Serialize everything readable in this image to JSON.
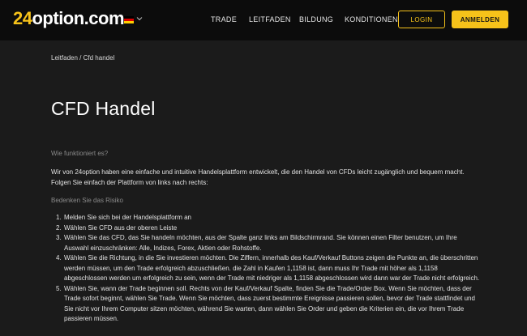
{
  "header": {
    "logo_digits": "24",
    "logo_text": "option.com",
    "language_icon": "german-flag-icon",
    "nav": [
      {
        "label": "TRADE"
      },
      {
        "label": "LEITFADEN"
      },
      {
        "label": "BILDUNG"
      },
      {
        "label": "KONDITIONEN"
      }
    ],
    "login_label": "LOGIN",
    "register_label": "ANMELDEN"
  },
  "colors": {
    "accent": "#f6c21a",
    "header_bg": "#0c0c0c",
    "page_bg": "#1b1b1b"
  },
  "breadcrumb": {
    "parent": "Leitfaden",
    "separator": "/",
    "current": "Cfd handel"
  },
  "article": {
    "title": "CFD Handel",
    "section1_heading": "Wie funktioniert es?",
    "section1_text": "Wir von 24option haben eine einfache und intuitive Handelsplattform entwickelt, die den Handel von CFDs leicht zugänglich und bequem macht. Folgen Sie einfach der Plattform von links nach rechts:",
    "section2_heading": "Bedenken Sie das Risiko",
    "steps": [
      {
        "num": "1.",
        "text": "Melden Sie sich bei der Handelsplattform an"
      },
      {
        "num": "2.",
        "text": "Wählen Sie CFD aus der oberen Leiste"
      },
      {
        "num": "3.",
        "text": "Wählen Sie das CFD, das Sie handeln möchten, aus der Spalte ganz links am Bildschirmrand. Sie können einen Filter benutzen, um Ihre Auswahl einzuschränken: Alle, Indizes, Forex, Aktien oder Rohstoffe."
      },
      {
        "num": "4.",
        "text": "Wählen Sie die Richtung, in die Sie investieren möchten. Die Ziffern, innerhalb des Kauf/Verkauf Buttons zeigen die Punkte an, die überschritten werden müssen, um den Trade erfolgreich abzuschließen. die Zahl in Kaufen 1,1158 ist, dann muss Ihr Trade mit höher als 1,1158 abgeschlossen werden um  erfolgreich zu sein, wenn der Trade mit niedriger als 1,1158 abgeschlossen wird dann war der Trade nicht erfolgreich."
      },
      {
        "num": "5.",
        "text": "Wählen Sie, wann der Trade beginnen soll. Rechts von der Kauf/Verkauf Spalte, finden Sie die Trade/Order Box. Wenn Sie möchten, dass der Trade sofort beginnt, wählen Sie Trade. Wenn Sie möchten, dass zuerst bestimmte Ereignisse passieren sollen, bevor der Trade stattfindet und Sie nicht vor Ihrem Computer sitzen möchten, während Sie warten, dann wählen Sie Order und geben die Kriterien ein, die vor Ihrem Trade passieren müssen."
      }
    ]
  }
}
